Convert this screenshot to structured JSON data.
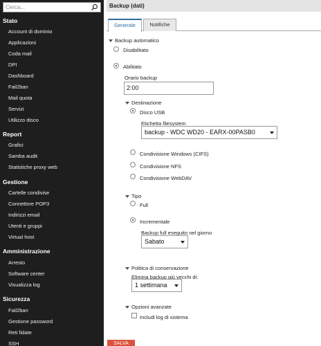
{
  "search": {
    "placeholder": "Cerca..."
  },
  "sidebar": {
    "sections": [
      {
        "title": "Stato",
        "items": [
          "Account di dominio",
          "Applicazioni",
          "Coda mail",
          "DPI",
          "Dashboard",
          "Fail2ban",
          "Mail quota",
          "Servizi",
          "Utilizzo disco"
        ]
      },
      {
        "title": "Report",
        "items": [
          "Grafici",
          "Samba audit",
          "Statistiche proxy web"
        ]
      },
      {
        "title": "Gestione",
        "items": [
          "Cartelle condivise",
          "Connettore POP3",
          "Indirizzi email",
          "Utenti e gruppi",
          "Virtual host"
        ]
      },
      {
        "title": "Amministrazione",
        "items": [
          "Arresto",
          "Software center",
          "Visualizza log"
        ]
      },
      {
        "title": "Sicurezza",
        "items": [
          "Fail2ban",
          "Gestione password",
          "Reti fidate",
          "SSH"
        ]
      }
    ]
  },
  "header": {
    "title": "Backup (dati)"
  },
  "tabs": [
    {
      "label": "Generale"
    },
    {
      "label": "Notifiche"
    }
  ],
  "form": {
    "backup_section": "Backup automatico",
    "disabled_label": "Disabilitato",
    "enabled_label": "Abilitato",
    "time_label": "Orario backup",
    "time_value": "2:00",
    "destination_section": "Destinazione",
    "usb_label": "Disco USB",
    "fs_label": "Etichetta filesystem",
    "fs_value": "backup - WDC WD20 - EARX-00PASB0",
    "cifs_label": "Condivisione Windows (CIFS)",
    "nfs_label": "Condivisione NFS",
    "webdav_label": "Condivisione WebDAV",
    "type_section": "Tipo",
    "full_label": "Full",
    "incremental_label": "Incrementale",
    "full_day_label": "Backup full eseguito nel giorno",
    "full_day_value": "Sabato",
    "retention_section": "Politica di conservazione",
    "delete_label": "Elimina backup più vecchi di:",
    "delete_value": "1 settimana",
    "advanced_section": "Opzioni avanzate",
    "include_logs_label": "Includi log di sistema",
    "save_label": "SALVA"
  },
  "colors": {
    "sidebar_bg": "#1e1e1e",
    "accent": "#2d6d9c",
    "save_button": "#d9533d"
  }
}
